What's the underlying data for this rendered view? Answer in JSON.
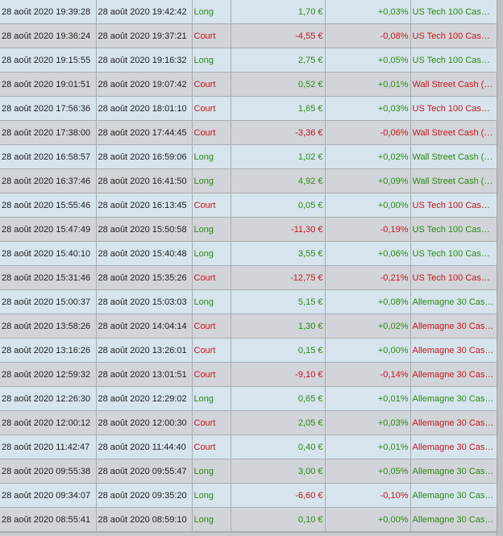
{
  "colors": {
    "positive": "#2d8a14",
    "negative": "#c8161e",
    "row_light": "#d6e4ed",
    "row_dark": "#d1d4d8"
  },
  "trades": [
    {
      "open": "28 août 2020 19:39:28",
      "close": "28 août 2020 19:42:42",
      "direction": "Long",
      "pl": "1,70 €",
      "pct": "+0,03%",
      "instrument": "US Tech 100 Cash ..."
    },
    {
      "open": "28 août 2020 19:36:24",
      "close": "28 août 2020 19:37:21",
      "direction": "Court",
      "pl": "-4,55 €",
      "pct": "-0,08%",
      "instrument": "US Tech 100 Cash ..."
    },
    {
      "open": "28 août 2020 19:15:55",
      "close": "28 août 2020 19:16:32",
      "direction": "Long",
      "pl": "2,75 €",
      "pct": "+0,05%",
      "instrument": "US Tech 100 Cash ..."
    },
    {
      "open": "28 août 2020 19:01:51",
      "close": "28 août 2020 19:07:42",
      "direction": "Court",
      "pl": "0,52 €",
      "pct": "+0,01%",
      "instrument": "Wall Street Cash (1..."
    },
    {
      "open": "28 août 2020 17:56:36",
      "close": "28 août 2020 18:01:10",
      "direction": "Court",
      "pl": "1,65 €",
      "pct": "+0,03%",
      "instrument": "US Tech 100 Cash ..."
    },
    {
      "open": "28 août 2020 17:38:00",
      "close": "28 août 2020 17:44:45",
      "direction": "Court",
      "pl": "-3,36 €",
      "pct": "-0,06%",
      "instrument": "Wall Street Cash (1..."
    },
    {
      "open": "28 août 2020 16:58:57",
      "close": "28 août 2020 16:59:06",
      "direction": "Long",
      "pl": "1,02 €",
      "pct": "+0,02%",
      "instrument": "Wall Street Cash (1..."
    },
    {
      "open": "28 août 2020 16:37:46",
      "close": "28 août 2020 16:41:50",
      "direction": "Long",
      "pl": "4,92 €",
      "pct": "+0,09%",
      "instrument": "Wall Street Cash (1..."
    },
    {
      "open": "28 août 2020 15:55:46",
      "close": "28 août 2020 16:13:45",
      "direction": "Court",
      "pl": "0,05 €",
      "pct": "+0,00%",
      "instrument": "US Tech 100 Cash ..."
    },
    {
      "open": "28 août 2020 15:47:49",
      "close": "28 août 2020 15:50:58",
      "direction": "Long",
      "pl": "-11,30 €",
      "pct": "-0,19%",
      "instrument": "US Tech 100 Cash ..."
    },
    {
      "open": "28 août 2020 15:40:10",
      "close": "28 août 2020 15:40:48",
      "direction": "Long",
      "pl": "3,55 €",
      "pct": "+0,06%",
      "instrument": "US Tech 100 Cash ..."
    },
    {
      "open": "28 août 2020 15:31:46",
      "close": "28 août 2020 15:35:26",
      "direction": "Court",
      "pl": "-12,75 €",
      "pct": "-0,21%",
      "instrument": "US Tech 100 Cash ..."
    },
    {
      "open": "28 août 2020 15:00:37",
      "close": "28 août 2020 15:03:03",
      "direction": "Long",
      "pl": "5,15 €",
      "pct": "+0,08%",
      "instrument": "Allemagne 30 Cash..."
    },
    {
      "open": "28 août 2020 13:58:26",
      "close": "28 août 2020 14:04:14",
      "direction": "Court",
      "pl": "1,30 €",
      "pct": "+0,02%",
      "instrument": "Allemagne 30 Cash..."
    },
    {
      "open": "28 août 2020 13:16:26",
      "close": "28 août 2020 13:26:01",
      "direction": "Court",
      "pl": "0,15 €",
      "pct": "+0,00%",
      "instrument": "Allemagne 30 Cash..."
    },
    {
      "open": "28 août 2020 12:59:32",
      "close": "28 août 2020 13:01:51",
      "direction": "Court",
      "pl": "-9,10 €",
      "pct": "-0,14%",
      "instrument": "Allemagne 30 Cash..."
    },
    {
      "open": "28 août 2020 12:26:30",
      "close": "28 août 2020 12:29:02",
      "direction": "Long",
      "pl": "0,65 €",
      "pct": "+0,01%",
      "instrument": "Allemagne 30 Cash..."
    },
    {
      "open": "28 août 2020 12:00:12",
      "close": "28 août 2020 12:00:30",
      "direction": "Court",
      "pl": "2,05 €",
      "pct": "+0,03%",
      "instrument": "Allemagne 30 Cash..."
    },
    {
      "open": "28 août 2020 11:42:47",
      "close": "28 août 2020 11:44:40",
      "direction": "Court",
      "pl": "0,40 €",
      "pct": "+0,01%",
      "instrument": "Allemagne 30 Cash..."
    },
    {
      "open": "28 août 2020 09:55:38",
      "close": "28 août 2020 09:55:47",
      "direction": "Long",
      "pl": "3,00 €",
      "pct": "+0,05%",
      "instrument": "Allemagne 30 Cash..."
    },
    {
      "open": "28 août 2020 09:34:07",
      "close": "28 août 2020 09:35:20",
      "direction": "Long",
      "pl": "-6,60 €",
      "pct": "-0,10%",
      "instrument": "Allemagne 30 Cash..."
    },
    {
      "open": "28 août 2020 08:55:41",
      "close": "28 août 2020 08:59:10",
      "direction": "Long",
      "pl": "0,10 €",
      "pct": "+0,00%",
      "instrument": "Allemagne 30 Cash..."
    }
  ]
}
